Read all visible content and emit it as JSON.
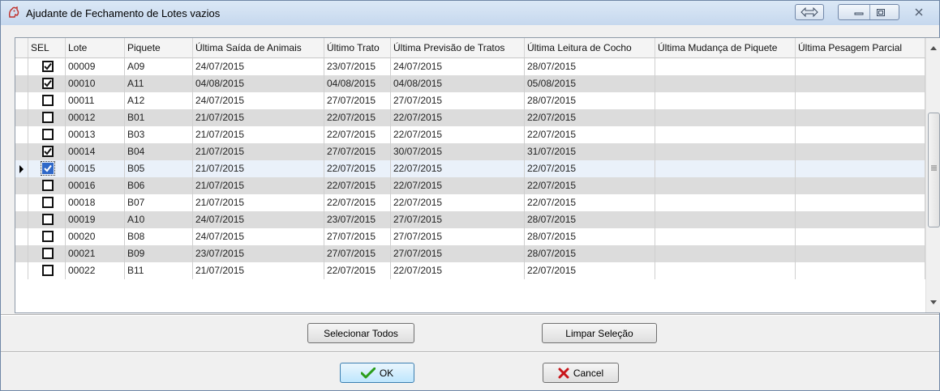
{
  "window": {
    "title": "Ajudante de Fechamento de Lotes vazios"
  },
  "columns": [
    "SEL",
    "Lote",
    "Piquete",
    "Última Saída de Animais",
    "Último Trato",
    "Última Previsão de Tratos",
    "Última Leitura de Cocho",
    "Última Mudança de Piquete",
    "Última Pesagem Parcial"
  ],
  "rows": [
    {
      "sel": true,
      "lote": "00009",
      "piquete": "A09",
      "saida": "24/07/2015",
      "trato": "23/07/2015",
      "previsao": "24/07/2015",
      "leitura": "28/07/2015",
      "mudanca": "",
      "pesagem": ""
    },
    {
      "sel": true,
      "lote": "00010",
      "piquete": "A11",
      "saida": "04/08/2015",
      "trato": "04/08/2015",
      "previsao": "04/08/2015",
      "leitura": "05/08/2015",
      "mudanca": "",
      "pesagem": ""
    },
    {
      "sel": false,
      "lote": "00011",
      "piquete": "A12",
      "saida": "24/07/2015",
      "trato": "27/07/2015",
      "previsao": "27/07/2015",
      "leitura": "28/07/2015",
      "mudanca": "",
      "pesagem": ""
    },
    {
      "sel": false,
      "lote": "00012",
      "piquete": "B01",
      "saida": "21/07/2015",
      "trato": "22/07/2015",
      "previsao": "22/07/2015",
      "leitura": "22/07/2015",
      "mudanca": "",
      "pesagem": ""
    },
    {
      "sel": false,
      "lote": "00013",
      "piquete": "B03",
      "saida": "21/07/2015",
      "trato": "22/07/2015",
      "previsao": "22/07/2015",
      "leitura": "22/07/2015",
      "mudanca": "",
      "pesagem": ""
    },
    {
      "sel": true,
      "lote": "00014",
      "piquete": "B04",
      "saida": "21/07/2015",
      "trato": "27/07/2015",
      "previsao": "30/07/2015",
      "leitura": "31/07/2015",
      "mudanca": "",
      "pesagem": ""
    },
    {
      "sel": true,
      "lote": "00015",
      "piquete": "B05",
      "saida": "21/07/2015",
      "trato": "22/07/2015",
      "previsao": "22/07/2015",
      "leitura": "22/07/2015",
      "mudanca": "",
      "pesagem": "",
      "current": true
    },
    {
      "sel": false,
      "lote": "00016",
      "piquete": "B06",
      "saida": "21/07/2015",
      "trato": "22/07/2015",
      "previsao": "22/07/2015",
      "leitura": "22/07/2015",
      "mudanca": "",
      "pesagem": ""
    },
    {
      "sel": false,
      "lote": "00018",
      "piquete": "B07",
      "saida": "21/07/2015",
      "trato": "22/07/2015",
      "previsao": "22/07/2015",
      "leitura": "22/07/2015",
      "mudanca": "",
      "pesagem": ""
    },
    {
      "sel": false,
      "lote": "00019",
      "piquete": "A10",
      "saida": "24/07/2015",
      "trato": "23/07/2015",
      "previsao": "27/07/2015",
      "leitura": "28/07/2015",
      "mudanca": "",
      "pesagem": ""
    },
    {
      "sel": false,
      "lote": "00020",
      "piquete": "B08",
      "saida": "24/07/2015",
      "trato": "27/07/2015",
      "previsao": "27/07/2015",
      "leitura": "28/07/2015",
      "mudanca": "",
      "pesagem": ""
    },
    {
      "sel": false,
      "lote": "00021",
      "piquete": "B09",
      "saida": "23/07/2015",
      "trato": "27/07/2015",
      "previsao": "27/07/2015",
      "leitura": "28/07/2015",
      "mudanca": "",
      "pesagem": ""
    },
    {
      "sel": false,
      "lote": "00022",
      "piquete": "B11",
      "saida": "21/07/2015",
      "trato": "22/07/2015",
      "previsao": "22/07/2015",
      "leitura": "22/07/2015",
      "mudanca": "",
      "pesagem": ""
    }
  ],
  "buttons": {
    "select_all": "Selecionar Todos",
    "clear_selection": "Limpar Seleção",
    "ok": "OK",
    "cancel": "Cancel"
  },
  "icons": {
    "app": "horse-head-icon",
    "ok": "check-icon",
    "cancel": "x-icon"
  },
  "colors": {
    "current_row": "#eaf1fa",
    "alt_row": "#dcdcdc",
    "ok_check": "#2a9d1a",
    "cancel_x": "#c8151a"
  }
}
